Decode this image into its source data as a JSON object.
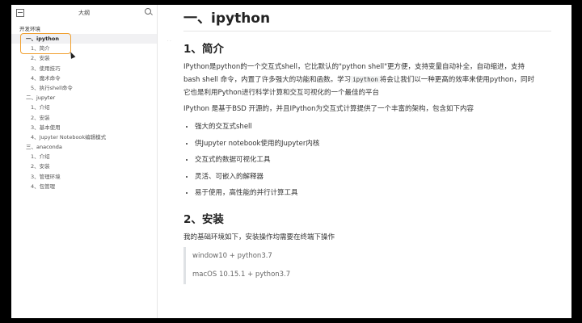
{
  "sidebar": {
    "title": "大纲",
    "root": "开发环境",
    "items": [
      {
        "label": "一、ipython",
        "level": 1,
        "active": true
      },
      {
        "label": "1、简介",
        "level": 2
      },
      {
        "label": "2、安装",
        "level": 2
      },
      {
        "label": "3、使用技巧",
        "level": 2
      },
      {
        "label": "4、魔术命令",
        "level": 2
      },
      {
        "label": "5、执行shell命令",
        "level": 2
      },
      {
        "label": "二、jupyter",
        "level": 1
      },
      {
        "label": "1、介绍",
        "level": 2
      },
      {
        "label": "2、安装",
        "level": 2
      },
      {
        "label": "3、基本使用",
        "level": 2
      },
      {
        "label": "4、Jupyter Notebook编辑模式",
        "level": 2
      },
      {
        "label": "三、anaconda",
        "level": 1
      },
      {
        "label": "1、介绍",
        "level": 2
      },
      {
        "label": "2、安装",
        "level": 2
      },
      {
        "label": "3、管理环境",
        "level": 2
      },
      {
        "label": "4、包管理",
        "level": 2
      }
    ]
  },
  "doc": {
    "h1": "一、ipython",
    "s1_title": "1、简介",
    "p1_a": "IPython是python的一个交互式shell，它比默认的\"python shell\"更方便，支持变量自动补全，自动缩进，支持 bash shell 命令，内置了许多强大的功能和函数。学习",
    "p1_code": "ipython",
    "p1_b": "将会让我们以一种更高的效率来使用python，同时它也是利用Python进行科学计算和交互可视化的一个最佳的平台",
    "p2": "IPython 是基于BSD 开源的，并且IPython为交互式计算提供了一个丰富的架构，包含如下内容",
    "bullets": [
      "强大的交互式shell",
      "供Jupyter notebook使用的Jupyter内核",
      "交互式的数据可视化工具",
      "灵活、可嵌入的解释器",
      "易于使用，高性能的并行计算工具"
    ],
    "s2_title": "2、安装",
    "p3": "我的基础环境如下，安装操作均需要在终端下操作",
    "quote": [
      "window10 + python3.7",
      "macOS 10.15.1 + python3.7"
    ]
  }
}
